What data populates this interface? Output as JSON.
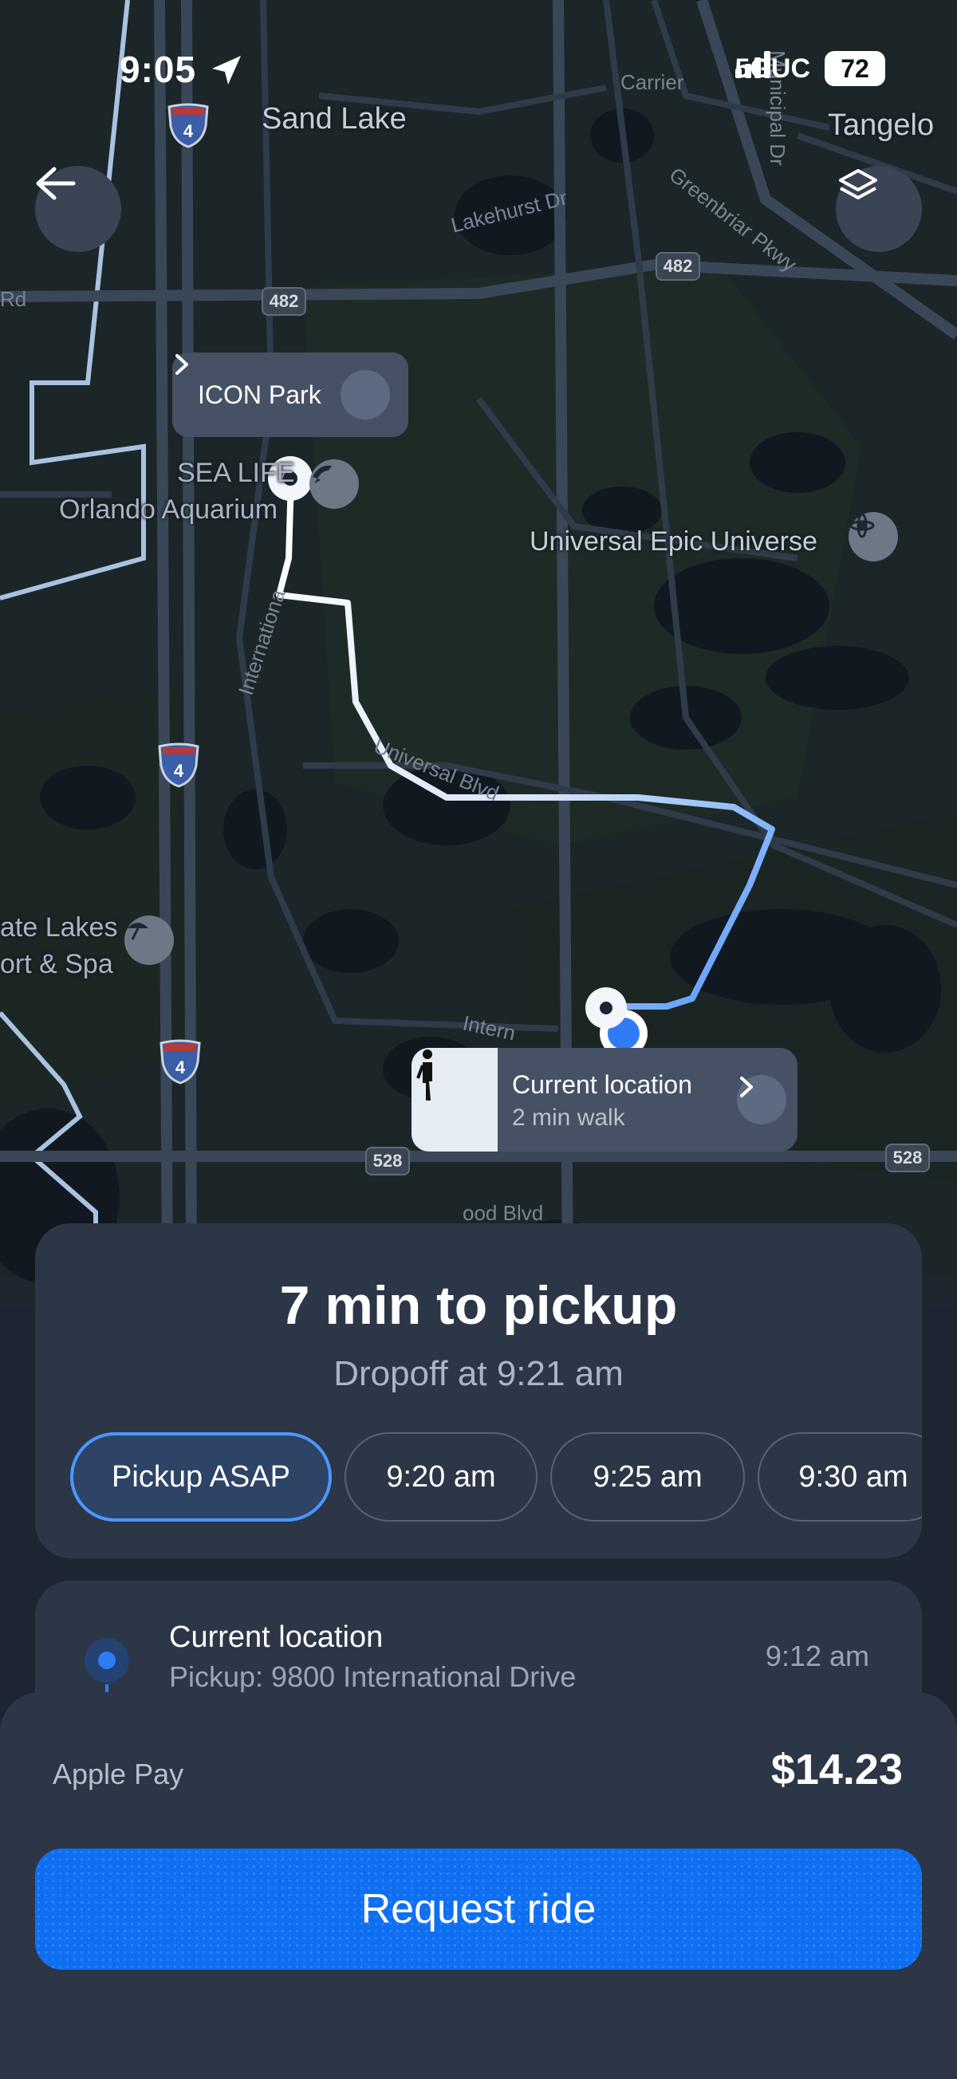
{
  "status_bar": {
    "time": "9:05",
    "network": "5GUC",
    "battery": "72"
  },
  "map": {
    "labels": {
      "sand_lake": "Sand Lake",
      "tangelo": "Tangelo",
      "sea_life": "SEA LIFE",
      "orlando_aquarium": "Orlando Aquarium",
      "universal_epic": "Universal Epic Universe",
      "lakes_resort_1": "ate Lakes",
      "lakes_resort_2": "ort & Spa"
    },
    "roads": {
      "lakehurst": "Lakehurst Dr",
      "greenbriar": "Greenbriar Pkwy",
      "universal_blvd": "Universal Blvd",
      "international": "Internationa",
      "international_2": "Intern",
      "carrier": "Carrier",
      "municipal": "Municipal Dr",
      "wood_blvd": "ood Blvd",
      "rd": "Rd"
    },
    "highway_482": "482",
    "highway_528": "528",
    "interstate_4": "4",
    "destination_callout": "ICON Park",
    "current_callout": {
      "title": "Current location",
      "subtitle": "2 min walk"
    }
  },
  "trip": {
    "pickup_eta": "7 min to pickup",
    "dropoff": "Dropoff at 9:21 am",
    "time_options": [
      "Pickup ASAP",
      "9:20 am",
      "9:25 am",
      "9:30 am"
    ]
  },
  "location": {
    "name": "Current location",
    "address": "Pickup: 9800 International Drive",
    "time": "9:12 am"
  },
  "payment": {
    "method": "Apple Pay",
    "price": "$14.23",
    "request_label": "Request ride"
  },
  "colors": {
    "accent": "#0f6ff2",
    "route": "#5ea3ff",
    "map_bg": "#1e2630"
  }
}
